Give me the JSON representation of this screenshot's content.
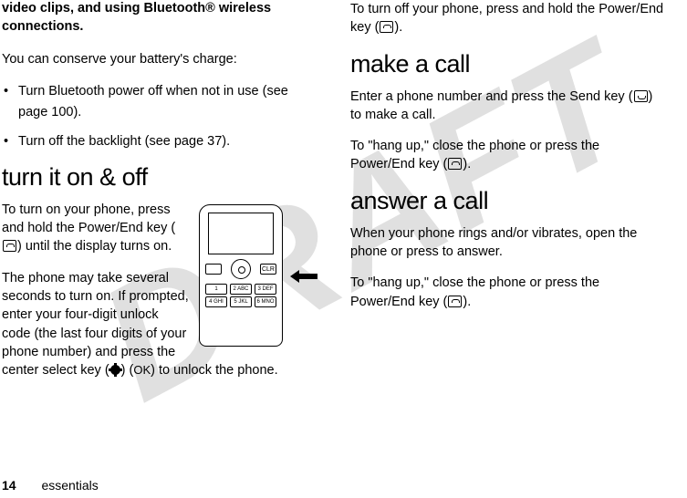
{
  "watermark": "DRAFT",
  "left": {
    "lead": "video clips, and using Bluetooth® wireless connections.",
    "conserve": "You can conserve your battery's charge:",
    "bullets": [
      "Turn Bluetooth power off when not in use (see page 100).",
      "Turn off the backlight (see page 37)."
    ],
    "h_turn": "turn it on & off",
    "turn_on_1": "To turn on your phone, press and hold the Power/End key (",
    "turn_on_2": ") until the display turns on.",
    "turn_on_3": "The phone may take several seconds to turn on. If prompted, enter your four-digit unlock code (the last four digits of your phone number) and press the center select key (",
    "turn_on_4": ") (",
    "ok_label": "OK",
    "turn_on_5": ") to unlock the phone.",
    "clr": "CLR",
    "keys": [
      "1",
      "2 ABC",
      "3 DEF",
      "4 GHI",
      "5 JKL",
      "6 MNO"
    ]
  },
  "right": {
    "turnoff_1": "To turn off your phone, press and hold the Power/End key (",
    "turnoff_2": ").",
    "h_make": "make a call",
    "make_1": "Enter a phone number and press the Send key (",
    "make_2": ") to make a call.",
    "make_3": "To \"hang up,\" close the phone or press the Power/End key (",
    "make_4": ").",
    "h_answer": "answer a call",
    "answer_1": "When your phone rings and/or vibrates, open the phone or press to answer.",
    "answer_2a": "To \"hang up,\" close the phone or press the Power/End key (",
    "answer_2b": ")."
  },
  "footer": {
    "page": "14",
    "section": "essentials"
  }
}
